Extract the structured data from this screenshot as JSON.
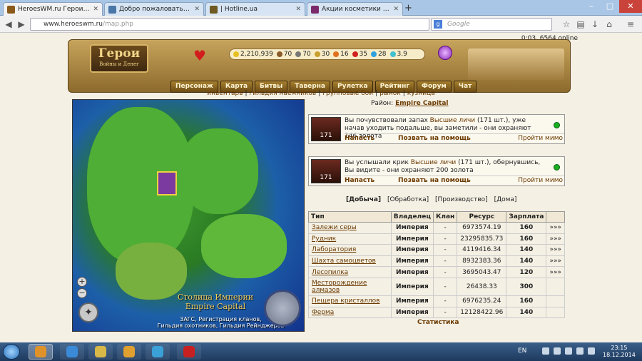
{
  "browser": {
    "tabs": [
      {
        "title": "HeroesWM.ru Герои войн...",
        "icon_color": "#8a5a1a"
      },
      {
        "title": "Добро пожаловать | ВКон...",
        "icon_color": "#4a76a8"
      },
      {
        "title": "| Hotline.ua",
        "icon_color": "#6e5a22"
      },
      {
        "title": "Акции косметики и парф...",
        "icon_color": "#7a2a6a"
      }
    ],
    "new_tab": "+",
    "url_host": "www.heroeswm.ru",
    "url_path": "/map.php",
    "search_placeholder": "Google",
    "search_engine_icon": "g"
  },
  "header": {
    "online": "0:03, 6564 online",
    "logo_title": "Герои",
    "logo_sub": "Войны и Денег",
    "resources": [
      {
        "value": "2,210,939",
        "color": "#e6c020"
      },
      {
        "value": "70",
        "color": "#8a5a2a"
      },
      {
        "value": "70",
        "color": "#777"
      },
      {
        "value": "30",
        "color": "#c8a030"
      },
      {
        "value": "16",
        "color": "#e07020"
      },
      {
        "value": "35",
        "color": "#d02020"
      },
      {
        "value": "28",
        "color": "#30a0e0"
      },
      {
        "value": "3.9",
        "color": "#40c0d0"
      }
    ],
    "menu": [
      "Персонаж",
      "Карта",
      "Битвы",
      "Таверна",
      "Рулетка",
      "Рейтинг",
      "Форум",
      "Чат"
    ],
    "submenu": [
      "инвентарь",
      "гильдия наёмников",
      "групповые бои",
      "рынок",
      "кузница"
    ]
  },
  "map": {
    "caption_ru": "Столица Империи",
    "caption_en": "Empire Capital",
    "sub_line1": "ЗАГС, Регистрация кланов,",
    "sub_line2": "Гильдия охотников, Гильдия Рейнджеров",
    "zoom_in": "+",
    "zoom_out": "−"
  },
  "district": {
    "label": "Район:",
    "name": "Empire Capital"
  },
  "events": [
    {
      "count": "171",
      "text_a": "Вы почувствовали запах ",
      "link": "Высшие личи",
      "text_b": " (171 шт.), уже начав уходить подальше, вы заметили - они охраняют 146 золота",
      "attack": "Напасть",
      "help": "Позвать на помощь",
      "pass": "Пройти мимо"
    },
    {
      "count": "171",
      "text_a": "Вы услышали крик ",
      "link": "Высшие личи",
      "text_b": " (171 шт.), обернувшись, Вы видите - они охраняют 200 золота",
      "attack": "Напасть",
      "help": "Позвать на помощь",
      "pass": "Пройти мимо"
    }
  ],
  "tabs": [
    "[Добыча]",
    "[Обработка]",
    "[Производство]",
    "[Дома]"
  ],
  "table": {
    "headers": [
      "Тип",
      "Владелец",
      "Клан",
      "Ресурс",
      "Зарплата",
      ""
    ],
    "rows": [
      [
        "Залежи серы",
        "Империя",
        "-",
        "6973574.19",
        "160",
        "»»»"
      ],
      [
        "Рудник",
        "Империя",
        "-",
        "23295835.73",
        "160",
        "»»»"
      ],
      [
        "Лаборатория",
        "Империя",
        "-",
        "4119416.34",
        "140",
        "»»»"
      ],
      [
        "Шахта самоцветов",
        "Империя",
        "-",
        "8932383.36",
        "140",
        "»»»"
      ],
      [
        "Лесопилка",
        "Империя",
        "-",
        "3695043.47",
        "120",
        "»»»"
      ],
      [
        "Месторождение алмазов",
        "Империя",
        "-",
        "26438.33",
        "300",
        ""
      ],
      [
        "Пещера кристаллов",
        "Империя",
        "-",
        "6976235.24",
        "160",
        ""
      ],
      [
        "Ферма",
        "Империя",
        "-",
        "12128422.96",
        "140",
        ""
      ]
    ]
  },
  "statistics": "Статистика",
  "taskbar": {
    "lang": "EN",
    "time": "23:15",
    "date": "18.12.2014",
    "apps": [
      "#e0922a",
      "#3a8ad8",
      "#d8b848",
      "#e0a030",
      "#3aa0d8",
      "#c82020"
    ]
  }
}
